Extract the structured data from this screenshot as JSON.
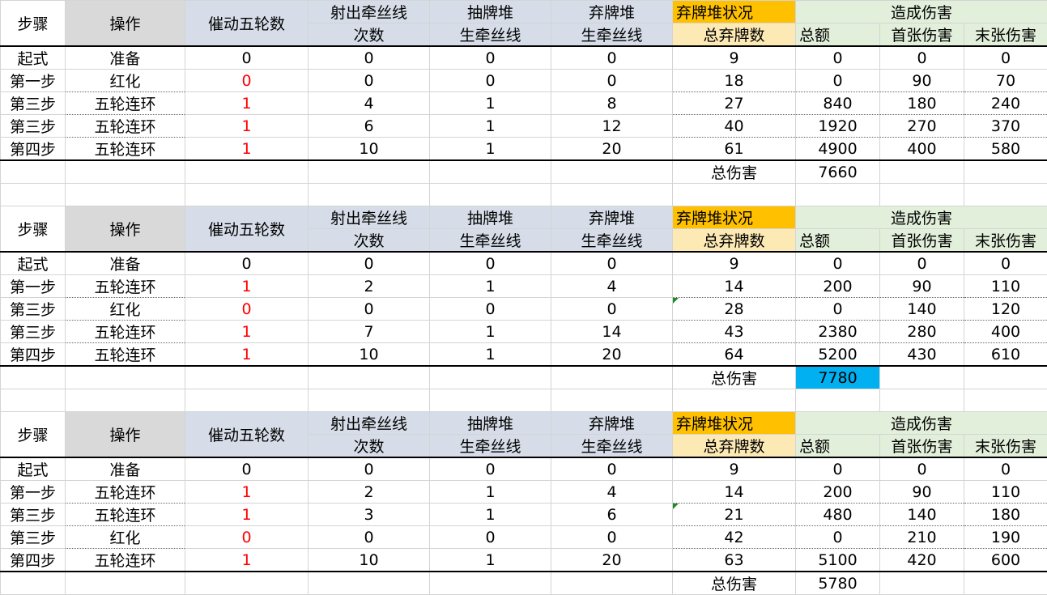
{
  "headers": {
    "step": "步骤",
    "op": "操作",
    "activate": "催动五轮数",
    "shoot_l1": "射出牵丝线",
    "shoot_l2": "次数",
    "draw_l1": "抽牌堆",
    "draw_l2": "生牵丝线",
    "discard_l1": "弃牌堆",
    "discard_l2": "生牵丝线",
    "pile_status": "弃牌堆状况",
    "total_discard": "总弃牌数",
    "damage": "造成伤害",
    "dmg_total": "总额",
    "dmg_first": "首张伤害",
    "dmg_last": "末张伤害"
  },
  "total_label": "总伤害",
  "colors": {
    "highlight": "#00b0f0",
    "red_value": "#ff0000",
    "pile_header": "#ffc000"
  },
  "tables": [
    {
      "total": "7660",
      "rows": [
        [
          "起式",
          "准备",
          "0",
          "0",
          "0",
          "0",
          "9",
          "0",
          "0",
          "0"
        ],
        [
          "第一步",
          "红化",
          "0",
          "0",
          "0",
          "0",
          "18",
          "0",
          "90",
          "70"
        ],
        [
          "第三步",
          "五轮连环",
          "1",
          "4",
          "1",
          "8",
          "27",
          "840",
          "180",
          "240"
        ],
        [
          "第三步",
          "五轮连环",
          "1",
          "6",
          "1",
          "12",
          "40",
          "1920",
          "270",
          "370"
        ],
        [
          "第四步",
          "五轮连环",
          "1",
          "10",
          "1",
          "20",
          "61",
          "4900",
          "400",
          "580"
        ]
      ]
    },
    {
      "total": "7780",
      "rows": [
        [
          "起式",
          "准备",
          "0",
          "0",
          "0",
          "0",
          "9",
          "0",
          "0",
          "0"
        ],
        [
          "第一步",
          "五轮连环",
          "1",
          "2",
          "1",
          "4",
          "14",
          "200",
          "90",
          "110"
        ],
        [
          "第三步",
          "红化",
          "0",
          "0",
          "0",
          "0",
          "28",
          "0",
          "140",
          "120"
        ],
        [
          "第三步",
          "五轮连环",
          "1",
          "7",
          "1",
          "14",
          "43",
          "2380",
          "280",
          "400"
        ],
        [
          "第四步",
          "五轮连环",
          "1",
          "10",
          "1",
          "20",
          "64",
          "5200",
          "430",
          "610"
        ]
      ]
    },
    {
      "total": "5780",
      "rows": [
        [
          "起式",
          "准备",
          "0",
          "0",
          "0",
          "0",
          "9",
          "0",
          "0",
          "0"
        ],
        [
          "第一步",
          "五轮连环",
          "1",
          "2",
          "1",
          "4",
          "14",
          "200",
          "90",
          "110"
        ],
        [
          "第三步",
          "五轮连环",
          "1",
          "3",
          "1",
          "6",
          "21",
          "480",
          "140",
          "180"
        ],
        [
          "第三步",
          "红化",
          "0",
          "0",
          "0",
          "0",
          "42",
          "0",
          "210",
          "190"
        ],
        [
          "第四步",
          "五轮连环",
          "1",
          "10",
          "1",
          "20",
          "63",
          "5100",
          "420",
          "600"
        ]
      ]
    }
  ]
}
